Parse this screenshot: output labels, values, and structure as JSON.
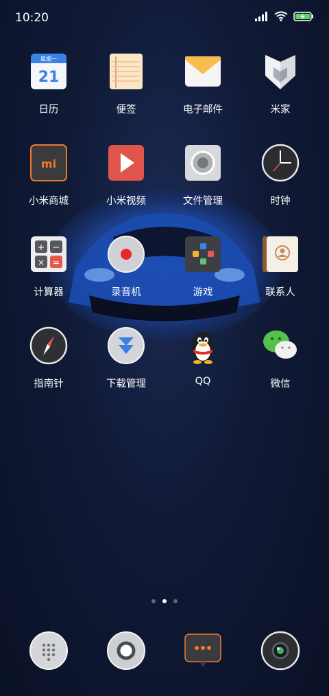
{
  "status_bar": {
    "time": "10:20",
    "icons": [
      "signal-icon",
      "wifi-icon",
      "battery-charging-icon"
    ]
  },
  "apps": [
    {
      "label": "日历",
      "icon": "calendar-icon",
      "calendar_header": "星期一",
      "calendar_day": "21"
    },
    {
      "label": "便签",
      "icon": "notes-icon"
    },
    {
      "label": "电子邮件",
      "icon": "email-icon"
    },
    {
      "label": "米家",
      "icon": "mijia-icon"
    },
    {
      "label": "小米商城",
      "icon": "mi-store-icon",
      "logo_text": "mi"
    },
    {
      "label": "小米视频",
      "icon": "video-play-icon"
    },
    {
      "label": "文件管理",
      "icon": "file-manager-icon"
    },
    {
      "label": "时钟",
      "icon": "clock-icon"
    },
    {
      "label": "计算器",
      "icon": "calculator-icon"
    },
    {
      "label": "录音机",
      "icon": "recorder-icon"
    },
    {
      "label": "游戏",
      "icon": "games-icon"
    },
    {
      "label": "联系人",
      "icon": "contacts-icon"
    },
    {
      "label": "指南针",
      "icon": "compass-icon"
    },
    {
      "label": "下载管理",
      "icon": "downloads-icon"
    },
    {
      "label": "QQ",
      "icon": "qq-penguin-icon"
    },
    {
      "label": "微信",
      "icon": "wechat-icon"
    }
  ],
  "page_indicator": {
    "pages": 3,
    "current": 2
  },
  "dock": [
    {
      "icon": "phone-dialer-icon"
    },
    {
      "icon": "browser-icon"
    },
    {
      "icon": "messages-icon"
    },
    {
      "icon": "camera-icon"
    }
  ]
}
